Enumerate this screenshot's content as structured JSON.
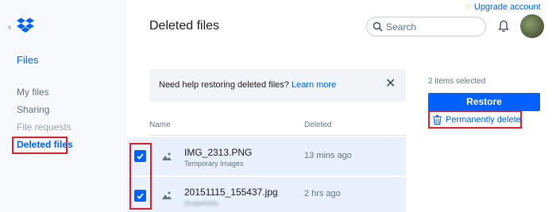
{
  "header": {
    "page_title": "Deleted files",
    "upgrade_label": "Upgrade account",
    "search_placeholder": "Search"
  },
  "sidebar": {
    "section_title": "Files",
    "items": [
      {
        "label": "My files",
        "state": "normal"
      },
      {
        "label": "Sharing",
        "state": "normal"
      },
      {
        "label": "File requests",
        "state": "muted"
      },
      {
        "label": "Deleted files",
        "state": "active"
      }
    ]
  },
  "banner": {
    "text": "Need help restoring deleted files?",
    "link": "Learn more"
  },
  "table": {
    "columns": [
      "Name",
      "Deleted"
    ],
    "rows": [
      {
        "name": "IMG_2313.PNG",
        "subtitle": "Temporary Images",
        "deleted": "13 mins ago",
        "checked": true
      },
      {
        "name": "20151115_155437.jpg",
        "subtitle": "Snapshots",
        "deleted": "2 hrs ago",
        "checked": true
      }
    ]
  },
  "panel": {
    "selected_count": "2 items selected",
    "restore_label": "Restore",
    "permanent_delete_label": "Permanently delete"
  },
  "colors": {
    "accent": "#0061fe",
    "highlight": "#d7222b",
    "selected_row": "#e8f1fd"
  }
}
